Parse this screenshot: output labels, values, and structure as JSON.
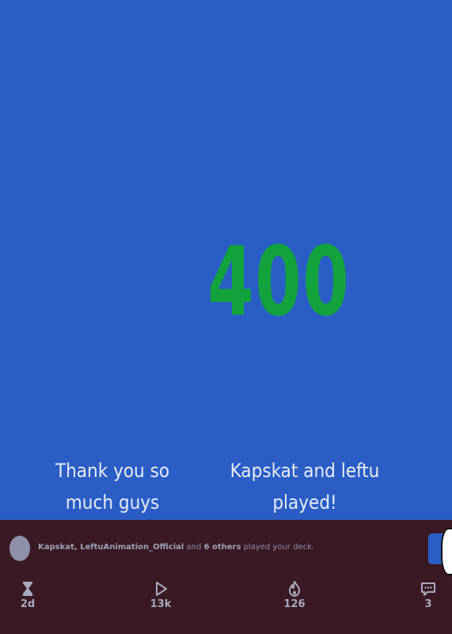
{
  "slide": {
    "number": "400",
    "caption_left": "Thank you so much guys",
    "caption_right": "Kapskat and leftu played!"
  },
  "notification": {
    "names": "Kapskat, LeftuAnimation_Official",
    "joiner": "and",
    "others": "6 others",
    "suffix": "played your deck."
  },
  "stats": {
    "age": "2d",
    "plays": "13k",
    "likes": "126",
    "comments": "3"
  },
  "colors": {
    "background": "#2a5ec6",
    "number": "#13a33c",
    "bar": "#3a1925"
  },
  "icons": [
    "hourglass-icon",
    "play-icon",
    "flame-icon",
    "comment-icon"
  ]
}
